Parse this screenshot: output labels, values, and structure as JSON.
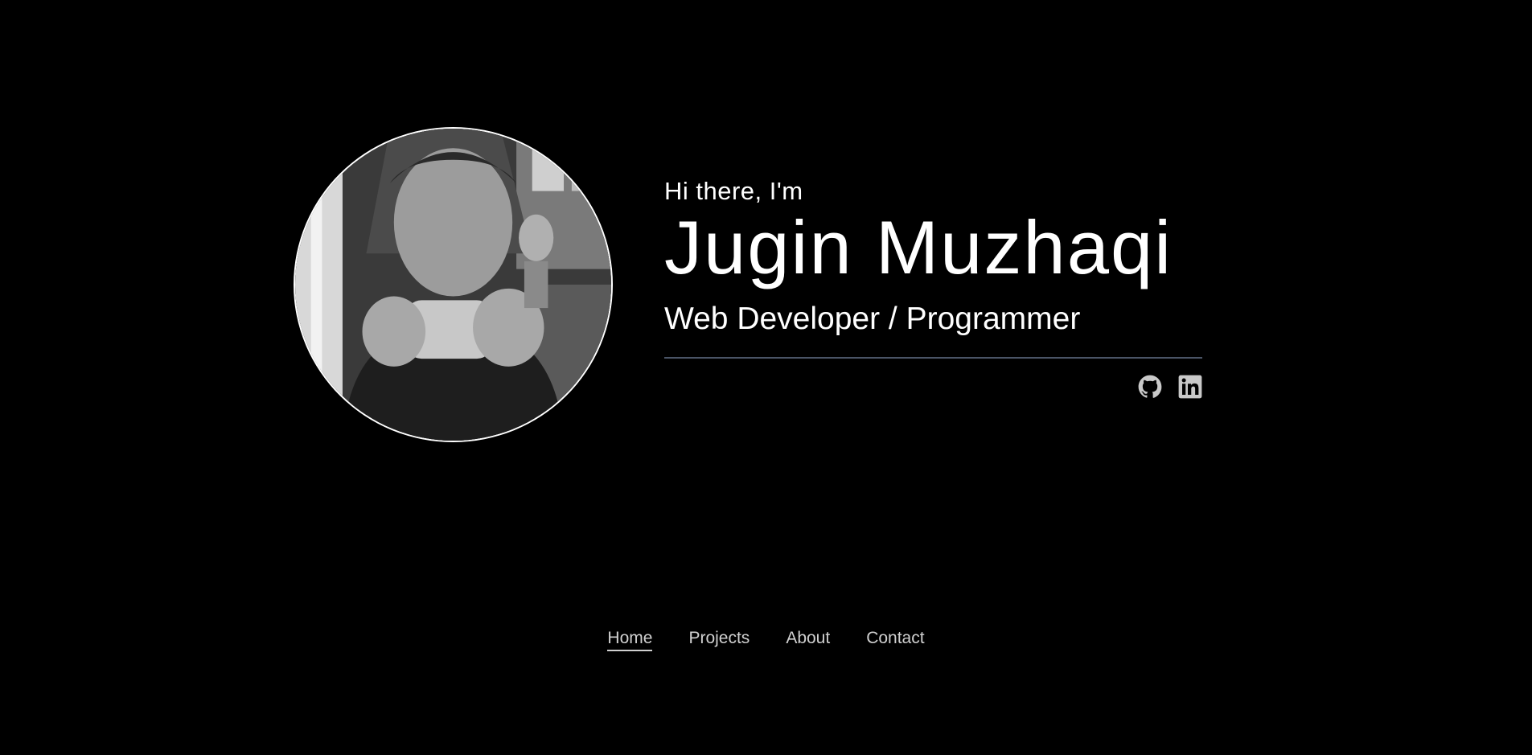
{
  "profile": {
    "photo_icon": "portrait-photo-drinking-coffee"
  },
  "intro": {
    "greeting": "Hi there, I'm",
    "name": "Jugin Muzhaqi",
    "role": "Web Developer / Programmer"
  },
  "socials": [
    {
      "icon": "github-icon",
      "label": "GitHub"
    },
    {
      "icon": "linkedin-icon",
      "label": "LinkedIn"
    }
  ],
  "nav": {
    "items": [
      {
        "label": "Home",
        "active": true
      },
      {
        "label": "Projects",
        "active": false
      },
      {
        "label": "About",
        "active": false
      },
      {
        "label": "Contact",
        "active": false
      }
    ]
  },
  "colors": {
    "background": "#000000",
    "text": "#ffffff",
    "divider": "#4a5466",
    "nav_text": "#d0d0d0"
  }
}
